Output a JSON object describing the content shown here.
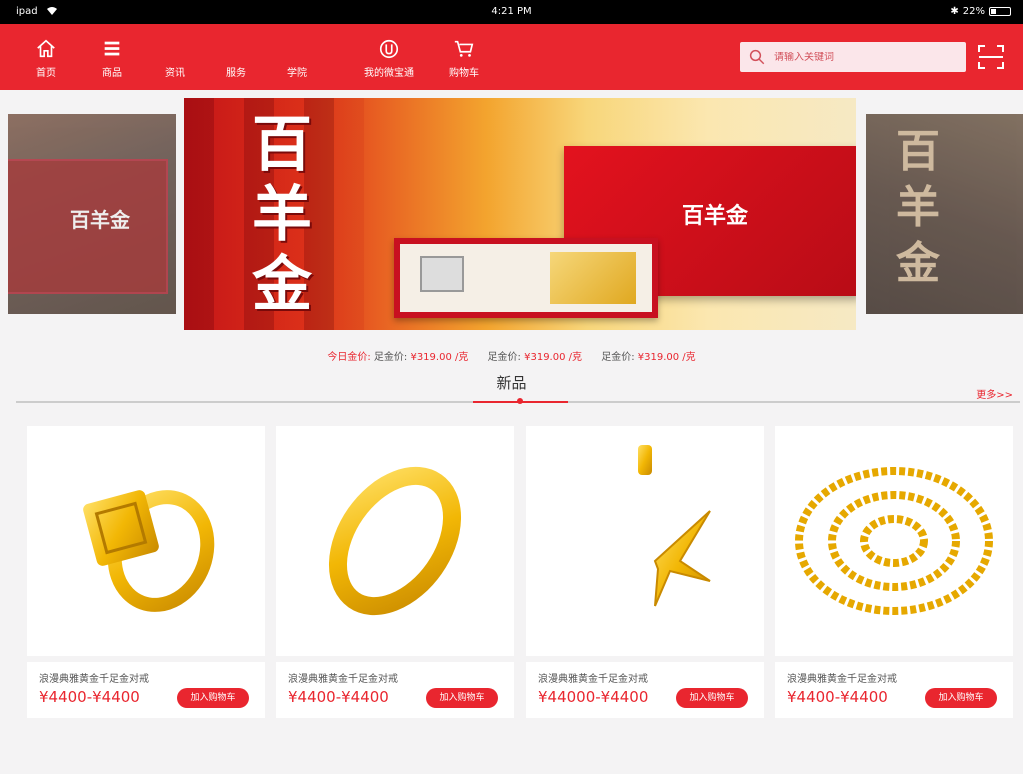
{
  "status": {
    "device": "ipad",
    "time": "4:21 PM",
    "battery": "22%"
  },
  "nav": {
    "items": [
      {
        "label": "首页",
        "icon": "home-icon"
      },
      {
        "label": "商品",
        "icon": "menu-list-icon"
      },
      {
        "label": "资讯"
      },
      {
        "label": "服务"
      },
      {
        "label": "学院"
      },
      {
        "label": "我的微宝通",
        "icon": "account-logo-icon"
      },
      {
        "label": "购物车",
        "icon": "cart-icon"
      }
    ],
    "search_placeholder": "请输入关键词"
  },
  "banner": {
    "title_chars": "百羊金",
    "box_text": "百羊金"
  },
  "ticker": {
    "prefix": "今日金价:",
    "items": [
      {
        "label": "足金价:",
        "price": "¥319.00 /克"
      },
      {
        "label": "足金价:",
        "price": "¥319.00 /克"
      },
      {
        "label": "足金价:",
        "price": "¥319.00 /克"
      }
    ]
  },
  "section": {
    "title": "新品",
    "more": "更多>>"
  },
  "products": [
    {
      "name": "浪漫典雅黄金千足金对戒",
      "price": "¥4400-¥4400",
      "button": "加入购物车",
      "image": "gold-ring"
    },
    {
      "name": "浪漫典雅黄金千足金对戒",
      "price": "¥4400-¥4400",
      "button": "加入购物车",
      "image": "gold-band"
    },
    {
      "name": "浪漫典雅黄金千足金对戒",
      "price": "¥44000-¥4400",
      "button": "加入购物车",
      "image": "gold-moon-pendant"
    },
    {
      "name": "浪漫典雅黄金千足金对戒",
      "price": "¥4400-¥4400",
      "button": "加入购物车",
      "image": "gold-chain"
    }
  ],
  "colors": {
    "brand_red": "#e9262f",
    "gold": "#f2b705",
    "background": "#f4f3f4"
  }
}
